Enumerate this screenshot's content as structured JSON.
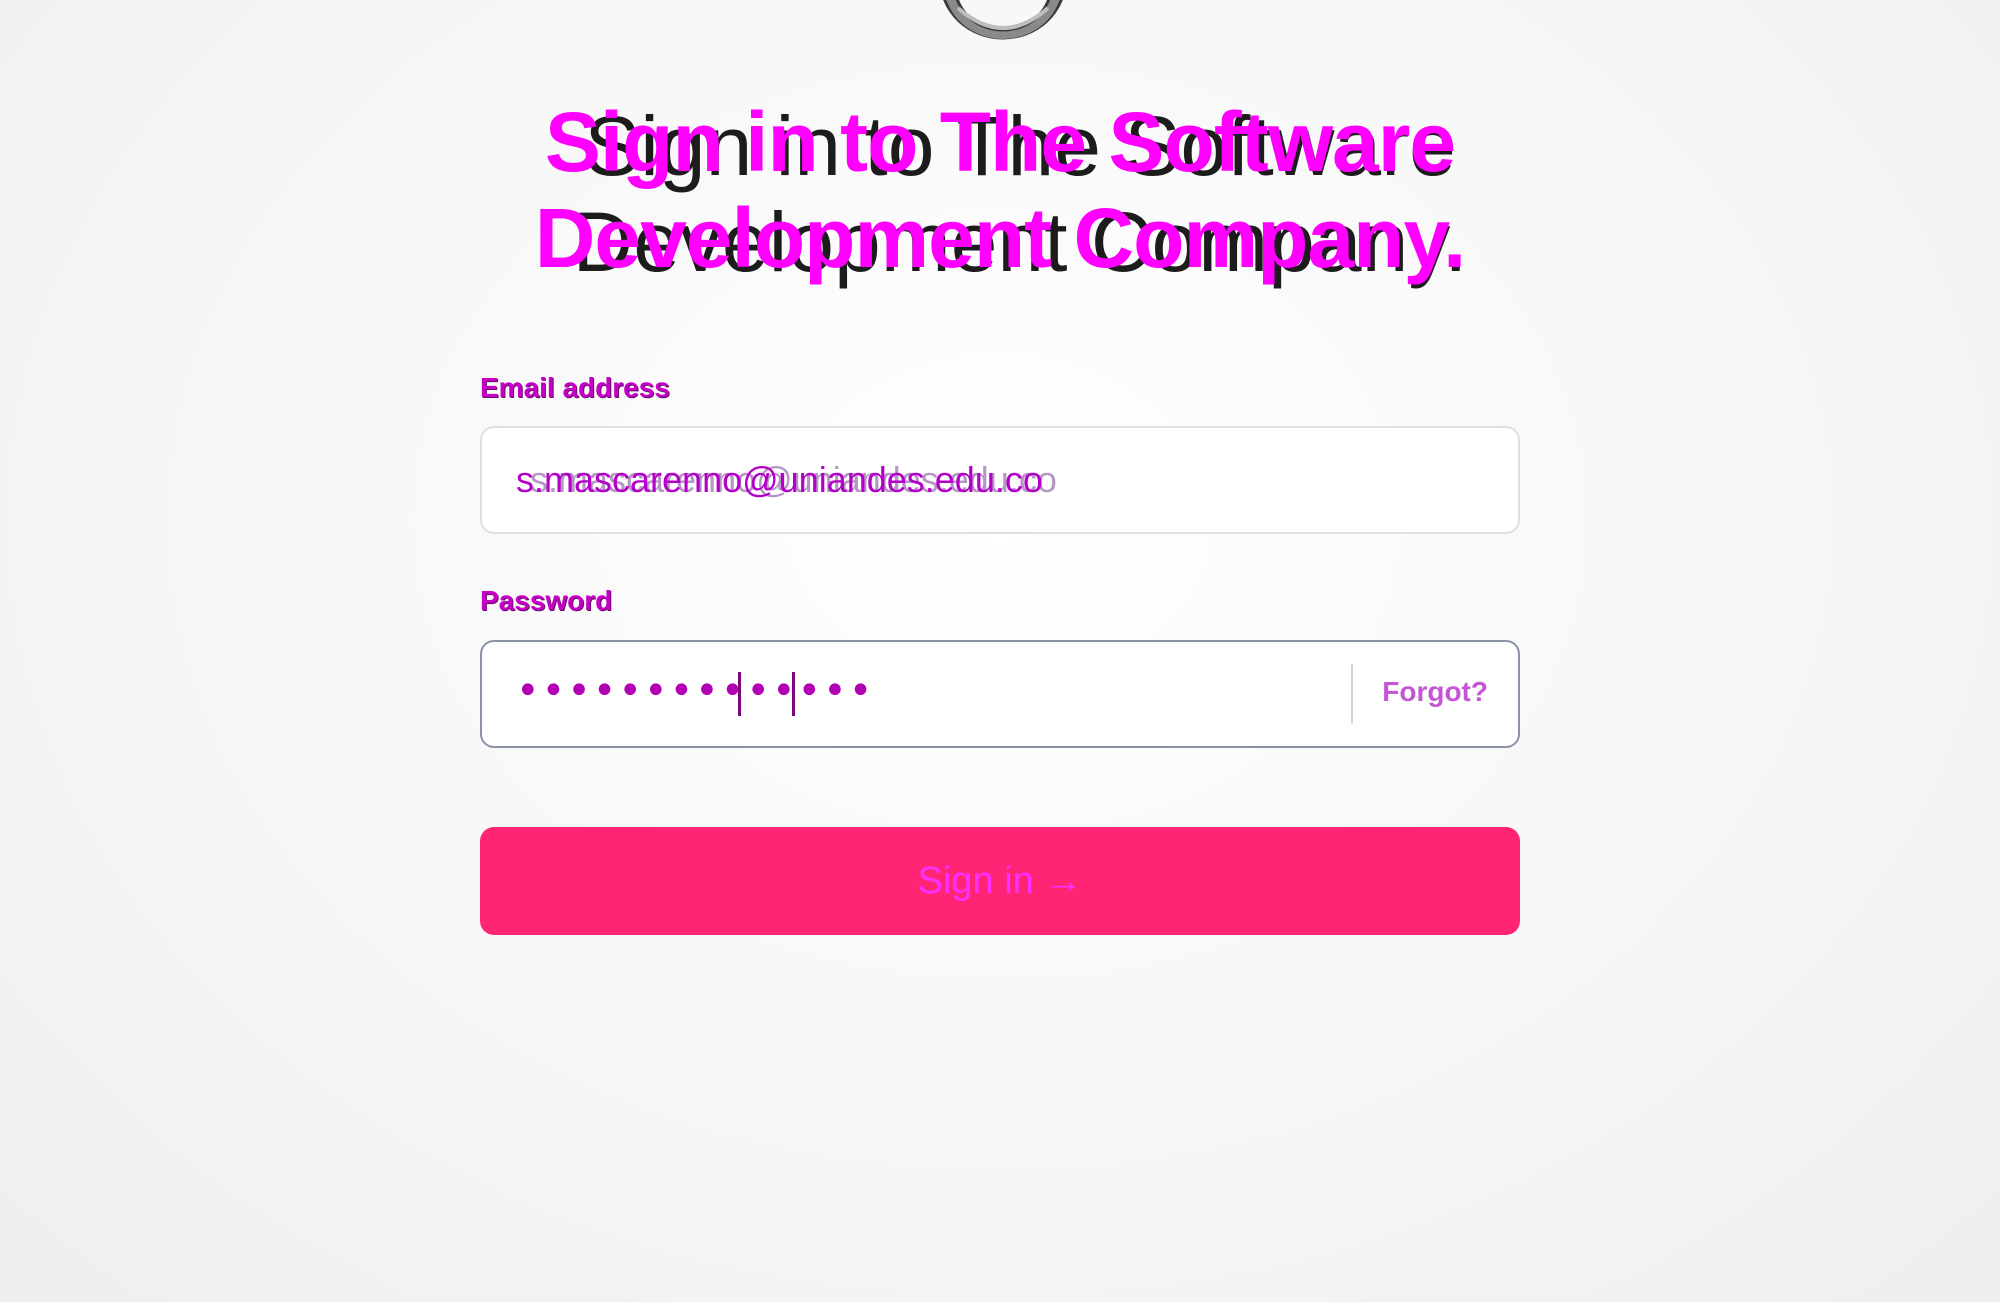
{
  "logo": {
    "icon": "ring-logo-icon"
  },
  "heading": {
    "line1": "Sign in to The Software",
    "line2": "Development Company."
  },
  "form": {
    "email_label": "Email address",
    "email_value": "s.mascarenno@uniandes.edu.co",
    "password_label": "Password",
    "password_value": "••••••••••••••",
    "forgot_label": "Forgot?",
    "submit_label": "Sign in →"
  },
  "colors": {
    "button": "#ff2474",
    "accent": "#ff00ff",
    "heading_text": "#1c1c1c"
  }
}
